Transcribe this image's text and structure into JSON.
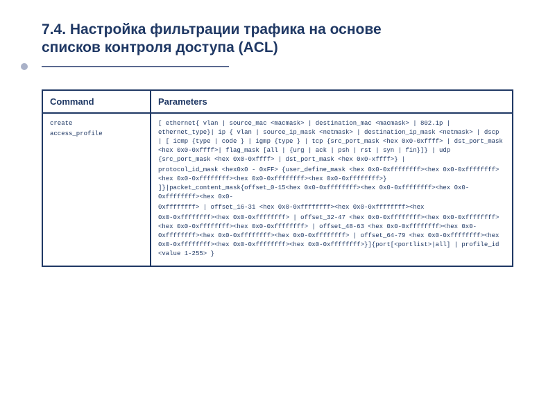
{
  "title_line1": "7.4. Настройка фильтрации трафика на основе",
  "title_line2": "списков контроля доступа (ACL)",
  "table": {
    "header_command": "Command",
    "header_parameters": "Parameters",
    "command_line1": "create",
    "command_line2": "access_profile",
    "param_line1": "[ ethernet{ vlan | source_mac <macmask> | destination_mac <macmask> | 802.1p | ethernet_type}| ip { vlan | source_ip_mask <netmask> | destination_ip_mask <netmask> | dscp | [ icmp {type | code } | igmp {type } | tcp {src_port_mask <hex 0x0-0xffff> | dst_port_mask <hex 0x0-0xffff>| flag_mask [all | {urg | ack | psh | rst | syn | fin}]} | udp {src_port_mask <hex 0x0-0xffff> | dst_port_mask <hex 0x0-xffff>} |",
    "param_line2": "protocol_id_mask <hex0x0 - 0xFF> {user_define_mask <hex 0x0-0xffffffff><hex 0x0-0xffffffff><hex 0x0-0xffffffff><hex 0x0-0xffffffff><hex 0x0-0xffffffff>} ]}|packet_content_mask{offset_0-15<hex 0x0-0xffffffff><hex 0x0-0xffffffff><hex 0x0-0xffffffff><hex 0x0-",
    "param_line3": "0xffffffff> | offset_16-31 <hex 0x0-0xffffffff><hex 0x0-0xffffffff><hex",
    "param_line4": "0x0-0xffffffff><hex 0x0-0xffffffff> | offset_32-47 <hex 0x0-0xffffffff><hex 0x0-0xffffffff><hex 0x0-0xffffffff><hex 0x0-0xffffffff> | offset_48-63 <hex 0x0-0xffffffff><hex 0x0-0xffffffff><hex 0x0-0xffffffff><hex 0x0-0xffffffff> | offset_64-79 <hex 0x0-0xffffffff><hex 0x0-0xffffffff><hex 0x0-0xffffffff><hex 0x0-0xffffffff>}]{port[<portlist>|all] | profile_id <value 1-255> }"
  }
}
